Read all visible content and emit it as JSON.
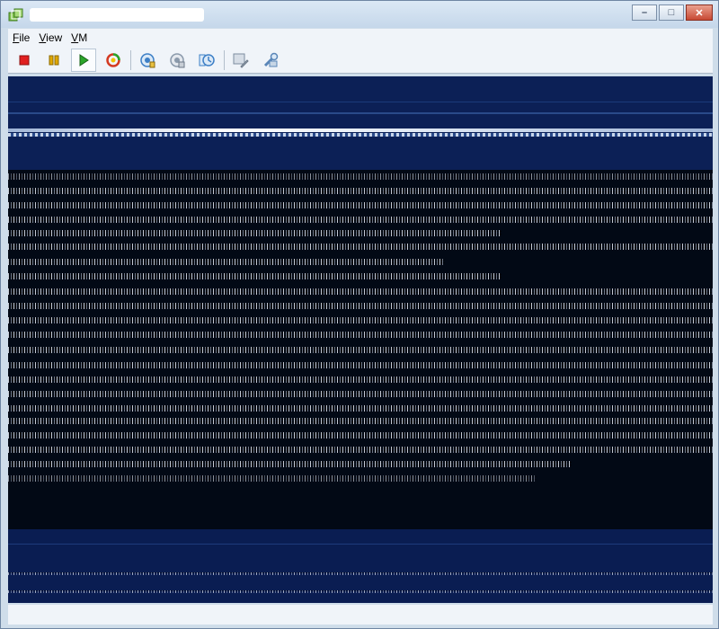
{
  "window": {
    "title": "",
    "controls": {
      "minimize": "–",
      "maximize": "□",
      "close": "✕"
    }
  },
  "menu": [
    "File",
    "View",
    "VM"
  ],
  "toolbar": {
    "buttons": [
      {
        "name": "stop-button",
        "icon": "stop-square-icon",
        "color": "#e02020"
      },
      {
        "name": "pause-button",
        "icon": "pause-icon",
        "color": "#e0a800"
      },
      {
        "name": "play-button",
        "icon": "play-triangle-icon",
        "color": "#2aa52a"
      },
      {
        "name": "reset-button",
        "icon": "reset-circle-icon",
        "color": "#d43a22"
      },
      {
        "name": "snapshot-button",
        "icon": "snapshot-icon",
        "color": "#3d7fc6"
      },
      {
        "name": "revert-snapshot-button",
        "icon": "revert-snapshot-icon",
        "color": "#8a99ab"
      },
      {
        "name": "snapshot-manager-button",
        "icon": "snapshot-manager-icon",
        "color": "#3d7fc6"
      },
      {
        "name": "console-settings-button",
        "icon": "console-settings-icon",
        "color": "#7d8da0"
      },
      {
        "name": "vm-settings-button",
        "icon": "vm-settings-icon",
        "color": "#5a86b8"
      }
    ]
  },
  "colors": {
    "console_dark": "#020915",
    "console_band": "#0c2056",
    "accent_blue": "#3d7fc6"
  }
}
